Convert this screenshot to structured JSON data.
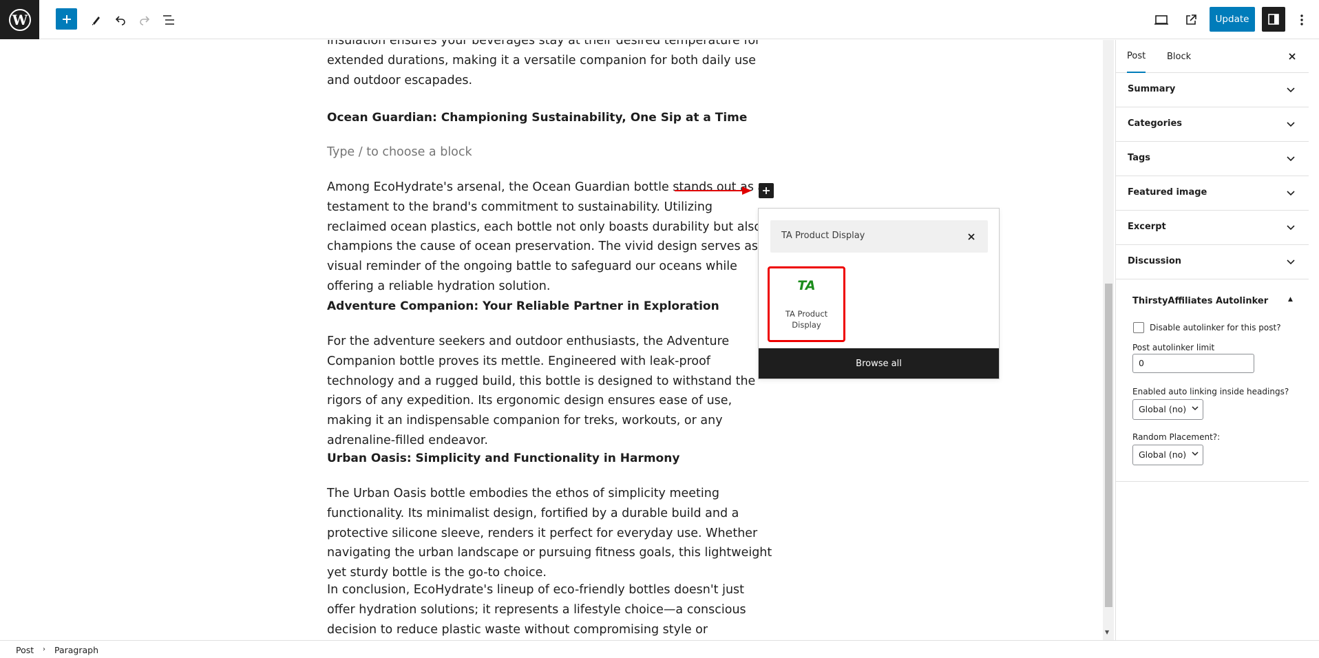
{
  "toolbar": {
    "update_label": "Update"
  },
  "editor": {
    "top_para": "insulation ensures your beverages stay at their desired temperature for extended durations, making it a versatile companion for both daily use and outdoor escapades.",
    "heading1": "Ocean Guardian: Championing Sustainability, One Sip at a Time",
    "placeholder": "Type / to choose a block",
    "para1": "Among EcoHydrate's arsenal, the Ocean Guardian bottle stands out as a testament to the brand's commitment to sustainability. Utilizing reclaimed ocean plastics, each bottle not only boasts durability but also champions the cause of ocean preservation. The vivid design serves as a visual reminder of the ongoing battle to safeguard our oceans while offering a reliable hydration solution.",
    "heading2": "Adventure Companion: Your Reliable Partner in Exploration",
    "para2": "For the adventure seekers and outdoor enthusiasts, the Adventure Companion bottle proves its mettle. Engineered with leak-proof technology and a rugged build, this bottle is designed to withstand the rigors of any expedition. Its ergonomic design ensures ease of use, making it an indispensable companion for treks, workouts, or any adrenaline-filled endeavor.",
    "heading3": "Urban Oasis: Simplicity and Functionality in Harmony",
    "para3": "The Urban Oasis bottle embodies the ethos of simplicity meeting functionality. Its minimalist design, fortified by a durable build and a protective silicone sleeve, renders it perfect for everyday use. Whether navigating the urban landscape or pursuing fitness goals, this lightweight yet sturdy bottle is the go-to choice.",
    "para4": "In conclusion, EcoHydrate's lineup of eco-friendly bottles doesn't just offer hydration solutions; it represents a lifestyle choice—a conscious decision to reduce plastic waste without compromising style or convenience. Embrace"
  },
  "inserter": {
    "search_value": "TA Product Display",
    "block_icon_text": "TA",
    "block_label": "TA Product Display",
    "browse_all": "Browse all"
  },
  "sidebar": {
    "tabs": [
      "Post",
      "Block"
    ],
    "panels": [
      "Summary",
      "Categories",
      "Tags",
      "Featured image",
      "Excerpt",
      "Discussion"
    ],
    "ta": {
      "title": "ThirstyAffiliates Autolinker",
      "disable_label": "Disable autolinker for this post?",
      "limit_label": "Post autolinker limit",
      "limit_value": "0",
      "headings_label": "Enabled auto linking inside headings?",
      "headings_value": "Global (no)",
      "random_label": "Random Placement?:",
      "random_value": "Global (no)"
    }
  },
  "footer": {
    "crumbs": [
      "Post",
      "Paragraph"
    ]
  },
  "colors": {
    "accent": "#007cba",
    "highlight_red": "#e00000",
    "ta_green": "#1a8c1a"
  }
}
